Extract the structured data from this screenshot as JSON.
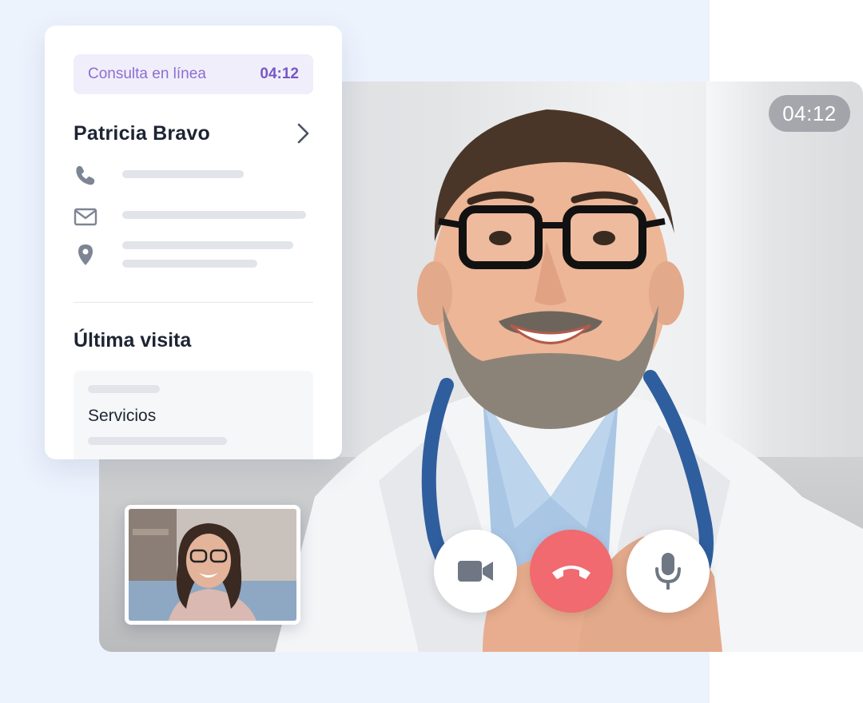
{
  "patient_card": {
    "status_label": "Consulta en línea",
    "status_time": "04:12",
    "patient_name": "Patricia Bravo",
    "info_icons": [
      "phone-icon",
      "mail-icon",
      "location-pin-icon"
    ],
    "section_title": "Última visita",
    "visit_service_label": "Servicios"
  },
  "video_call": {
    "timer": "04:12",
    "controls": [
      "camera-icon",
      "hang-up-icon",
      "microphone-icon"
    ]
  },
  "colors": {
    "accent_purple": "#7658c6",
    "status_bg": "#f1eefb",
    "hangup_red": "#f06a6f",
    "page_bg": "#edf3fd",
    "icon_gray": "#7d8594"
  }
}
